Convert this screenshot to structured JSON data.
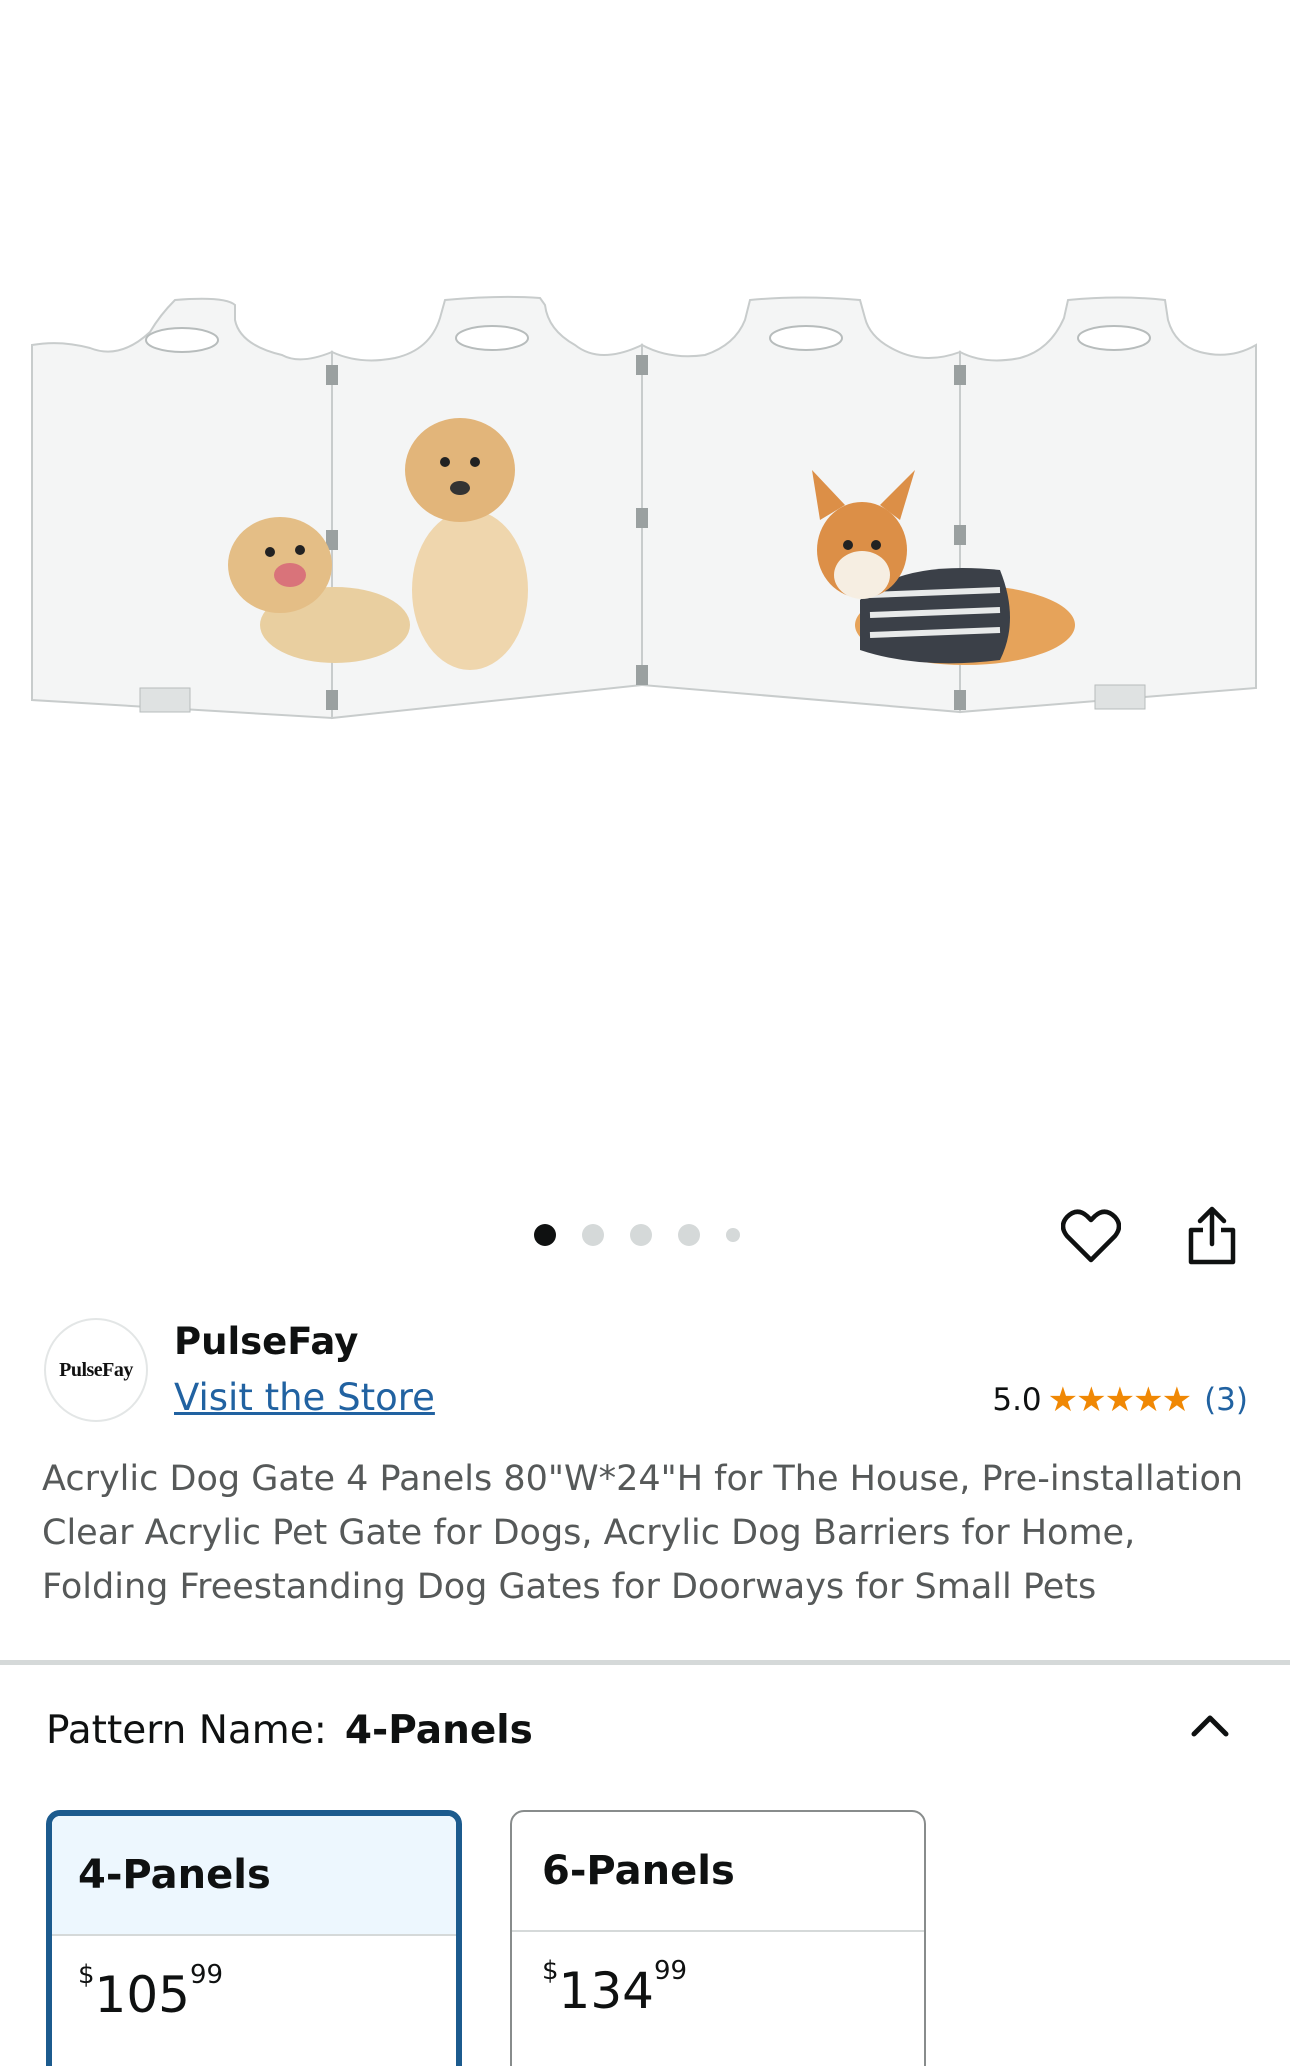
{
  "product_image": {
    "alt_icon": "acrylic-dog-gate-product-image"
  },
  "carousel": {
    "dot_count": 5,
    "active_index": 0
  },
  "actions": {
    "favorite_icon": "heart-icon",
    "share_icon": "share-icon"
  },
  "brand": {
    "logo_text": "PulseFay",
    "name": "PulseFay",
    "visit_store": "Visit the Store"
  },
  "rating": {
    "score": "5.0",
    "stars": "★★★★★",
    "count": "(3)",
    "color": "#f08804"
  },
  "product_title": "Acrylic Dog Gate 4 Panels 80\"W*24\"H for The House, Pre-installation Clear Acrylic Pet Gate for Dogs, Acrylic Dog Barriers for Home, Folding Freestanding Dog Gates for Doorways for Small Pets",
  "variation": {
    "label": "Pattern Name:",
    "selected": "4-Panels",
    "options": [
      {
        "name": "4-Panels",
        "currency": "$",
        "whole": "105",
        "fraction": "99"
      },
      {
        "name": "6-Panels",
        "currency": "$",
        "whole": "134",
        "fraction": "99"
      }
    ]
  },
  "colors": {
    "link": "#2162a1",
    "selected_border": "#1c5b8e",
    "selected_bg": "#edf7fe"
  }
}
